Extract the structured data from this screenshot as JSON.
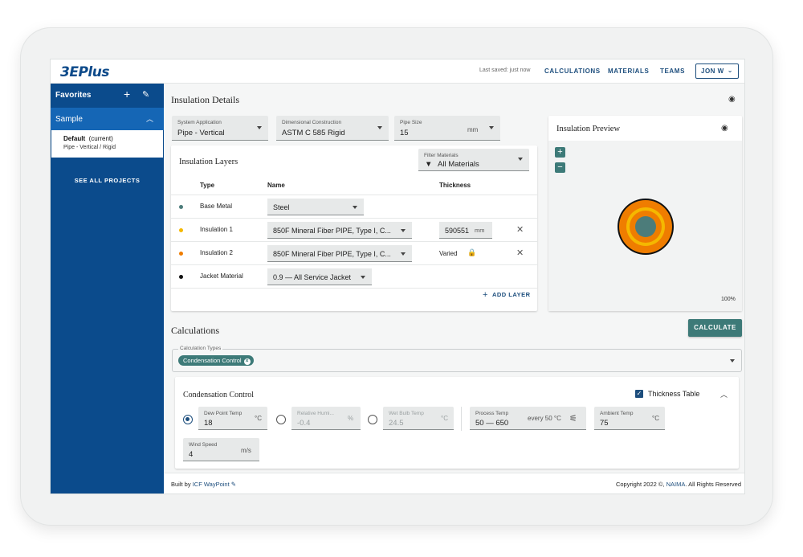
{
  "app": {
    "logo_prefix": "3E",
    "logo_suffix": "Plus",
    "last_saved": "Last saved: just now",
    "nav": [
      "CALCULATIONS",
      "MATERIALS",
      "TEAMS"
    ],
    "user": "JON W"
  },
  "sidebar": {
    "favorites_label": "Favorites",
    "project_name": "Sample",
    "current_name": "Default",
    "current_tag": "(current)",
    "current_desc": "Pipe - Vertical / Rigid",
    "see_all": "SEE ALL PROJECTS"
  },
  "details": {
    "title": "Insulation Details",
    "system_app": {
      "label": "System Application",
      "value": "Pipe - Vertical"
    },
    "dim_construction": {
      "label": "Dimensional Construction",
      "value": "ASTM C 585 Rigid"
    },
    "pipe_size": {
      "label": "Pipe Size",
      "value": "15",
      "unit": "mm"
    }
  },
  "layers": {
    "title": "Insulation Layers",
    "filter": {
      "label": "Filter Materials",
      "value": "All Materials"
    },
    "headers": {
      "type": "Type",
      "name": "Name",
      "thickness": "Thickness"
    },
    "rows": [
      {
        "type": "Base Metal",
        "name": "Steel",
        "color": "#4c7c7a"
      },
      {
        "type": "Insulation 1",
        "name": "850F Mineral Fiber PIPE, Type I, C...",
        "thickness": "590551",
        "unit": "mm",
        "color": "#f5b800"
      },
      {
        "type": "Insulation 2",
        "name": "850F Mineral Fiber PIPE, Type I, C...",
        "thickness_text": "Varied",
        "color": "#ef7d00"
      },
      {
        "type": "Jacket Material",
        "name": "0.9 — All Service Jacket",
        "color": "#111111"
      }
    ],
    "add_layer": "ADD LAYER"
  },
  "preview": {
    "title": "Insulation Preview",
    "zoom": "100%",
    "colors": {
      "jacket": "#111111",
      "insulation2": "#ef7d00",
      "insulation1": "#f5b800",
      "core": "#4c7c7a"
    }
  },
  "calculations": {
    "title": "Calculations",
    "calculate_button": "CALCULATE",
    "types_label": "Calculation Types",
    "chip": "Condensation Control",
    "cc": {
      "title": "Condensation Control",
      "thickness_table": "Thickness Table",
      "dew_point": {
        "label": "Dew Point Temp",
        "value": "18",
        "unit": "°C"
      },
      "humidity": {
        "label": "Relative Humi...",
        "value": "-0.4",
        "unit": "%"
      },
      "wet_bulb": {
        "label": "Wet Bulb Temp",
        "value": "24.5",
        "unit": "°C"
      },
      "process": {
        "label": "Process Temp",
        "value": "50 — 650",
        "step": "every 50 °C"
      },
      "ambient": {
        "label": "Ambient Temp",
        "value": "75",
        "unit": "°C"
      },
      "wind": {
        "label": "Wind Speed",
        "value": "4",
        "unit": "m/s"
      }
    }
  },
  "footer": {
    "built_by": "Built by",
    "built_link": "ICF WayPoint",
    "copyright": "Copyright 2022 ©,",
    "copy_link": "NAIMA",
    "rights": ". All Rights Reserved"
  },
  "theme": {
    "primary": "#0b4b8c",
    "accent": "#3d7a78",
    "link": "#1d4e7d"
  }
}
